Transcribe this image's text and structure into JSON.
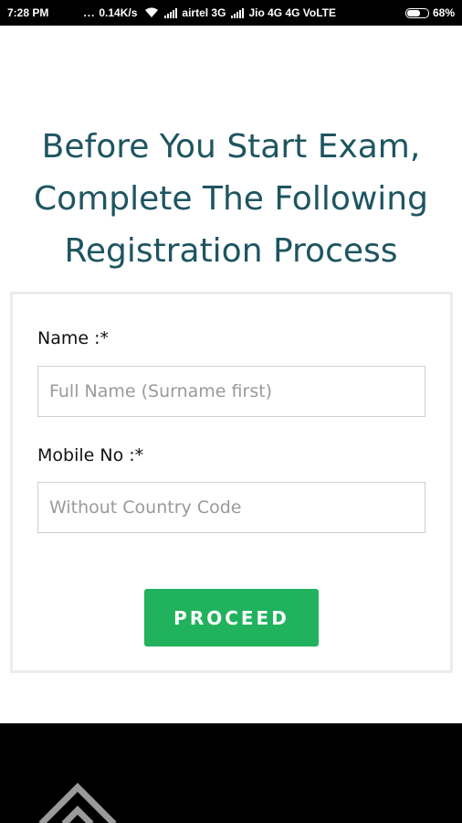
{
  "status_bar": {
    "time": "7:28 PM",
    "dots": "...",
    "net_speed": "0.14K/s",
    "carrier1": "airtel 3G",
    "carrier2": "Jio 4G 4G VoLTE",
    "battery": "68%",
    "battery_level": 0.68
  },
  "heading": {
    "line1": "Before You Start Exam,",
    "line2": "Complete The Following",
    "line3": "Registration Process"
  },
  "form": {
    "name_label": "Name :*",
    "name_placeholder": "Full Name (Surname first)",
    "mobile_label": "Mobile No :*",
    "mobile_placeholder": "Without Country Code",
    "proceed_label": "PROCEED"
  },
  "colors": {
    "heading": "#1d5560",
    "button": "#21b25d",
    "footer": "#000000"
  }
}
